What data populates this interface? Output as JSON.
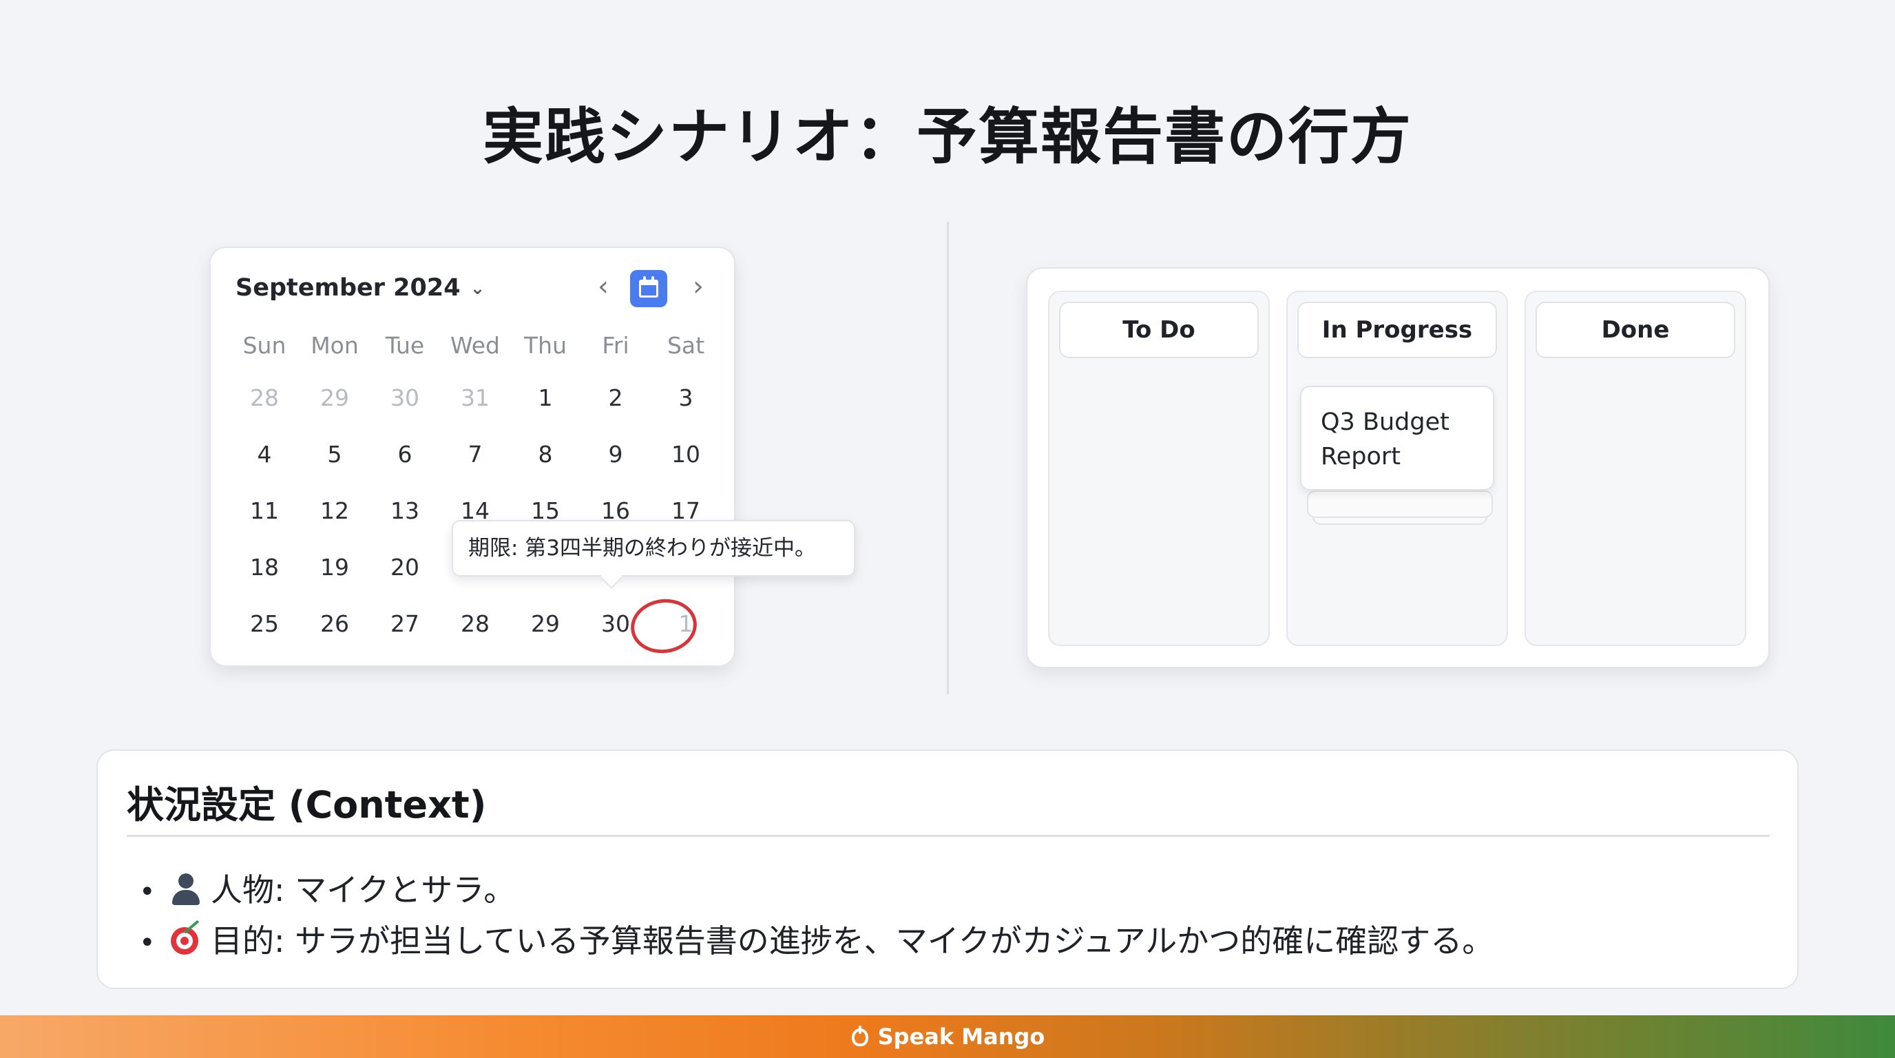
{
  "title": "実践シナリオ：予算報告書の行方",
  "calendar": {
    "month_label": "September 2024",
    "weekdays": [
      "Sun",
      "Mon",
      "Tue",
      "Wed",
      "Thu",
      "Fri",
      "Sat"
    ],
    "weeks": [
      [
        "28",
        "29",
        "30",
        "31",
        "1",
        "2",
        "3"
      ],
      [
        "4",
        "5",
        "6",
        "7",
        "8",
        "9",
        "10"
      ],
      [
        "11",
        "12",
        "13",
        "14",
        "15",
        "16",
        "17"
      ],
      [
        "18",
        "19",
        "20",
        "",
        "",
        "",
        ""
      ],
      [
        "25",
        "26",
        "27",
        "28",
        "29",
        "30",
        "1"
      ]
    ],
    "highlighted_day": "30",
    "highlight_color": "#d8343a",
    "accent_color": "#4a7cf0",
    "tooltip": "期限: 第3四半期の終わりが接近中。"
  },
  "kanban": {
    "columns": [
      {
        "title": "To Do",
        "cards": []
      },
      {
        "title": "In Progress",
        "cards": [
          "Q3 Budget Report"
        ]
      },
      {
        "title": "Done",
        "cards": []
      }
    ]
  },
  "context": {
    "title": "状況設定 (Context)",
    "items": [
      {
        "icon": "person-icon",
        "text": "人物: マイクとサラ。"
      },
      {
        "icon": "target-icon",
        "text": "目的: サラが担当している予算報告書の進捗を、マイクがカジュアルかつ的確に確認する。"
      }
    ]
  },
  "footer": {
    "brand": "Speak Mango"
  }
}
